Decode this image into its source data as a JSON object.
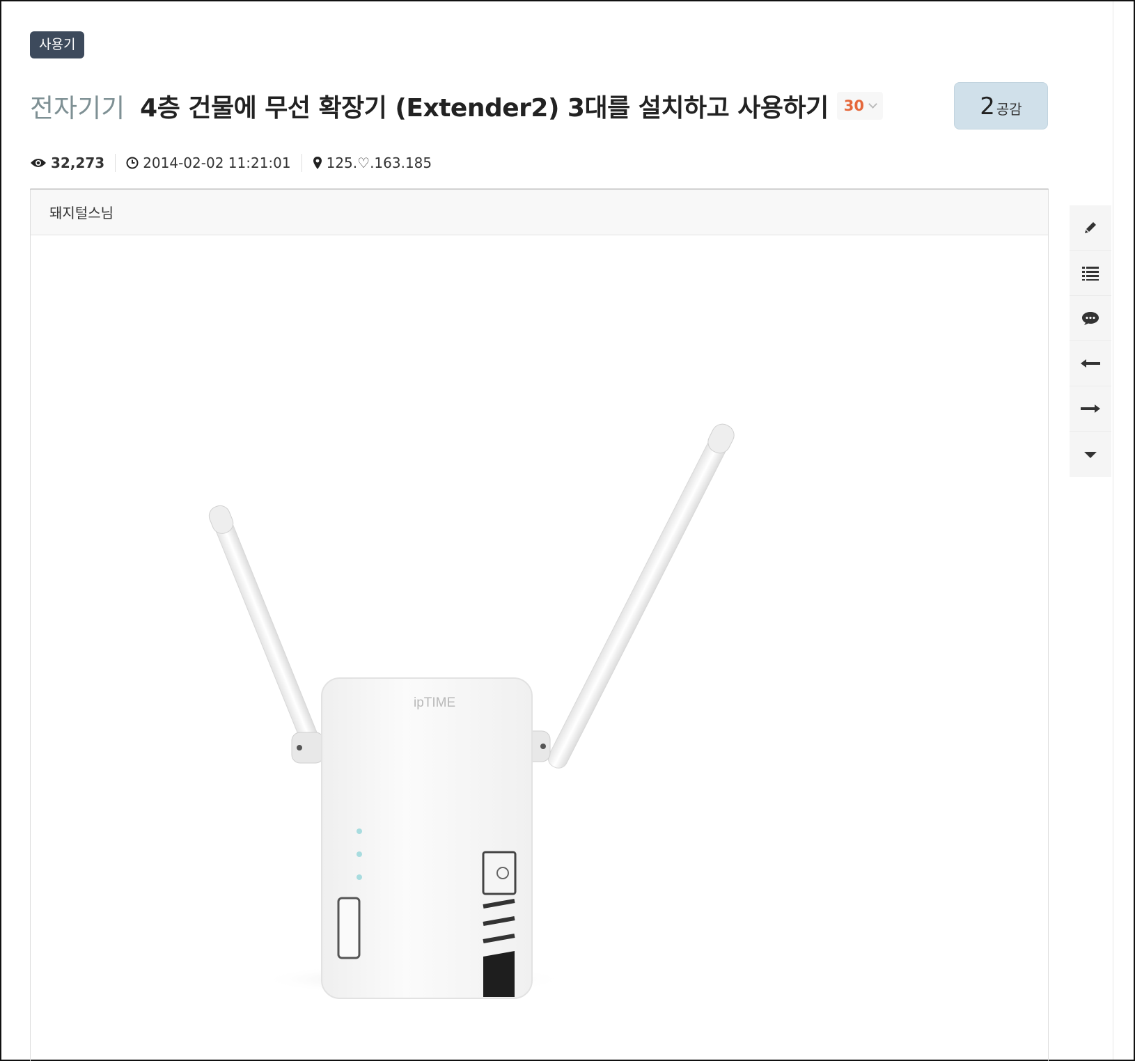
{
  "category_badge": "사용기",
  "board_name": "전자기기",
  "post_title": "4층 건물에 무선 확장기 (Extender2) 3대를 설치하고 사용하기",
  "comment_count": "30",
  "like": {
    "count": "2",
    "label": "공감"
  },
  "meta": {
    "views": "32,273",
    "datetime": "2014-02-02 11:21:01",
    "ip": "125.♡.163.185"
  },
  "author": "돼지털스님",
  "post_image": {
    "brand": "ipTIME"
  },
  "side_toolbar": [
    {
      "icon": "pencil-icon"
    },
    {
      "icon": "list-icon"
    },
    {
      "icon": "comment-icon"
    },
    {
      "icon": "arrow-left-icon"
    },
    {
      "icon": "arrow-right-icon"
    },
    {
      "icon": "caret-down-icon"
    }
  ],
  "colors": {
    "badge_bg": "#3d4a5c",
    "board_name": "#7e9094",
    "comment_count": "#e5673a",
    "like_bg": "#d0e0ea"
  }
}
